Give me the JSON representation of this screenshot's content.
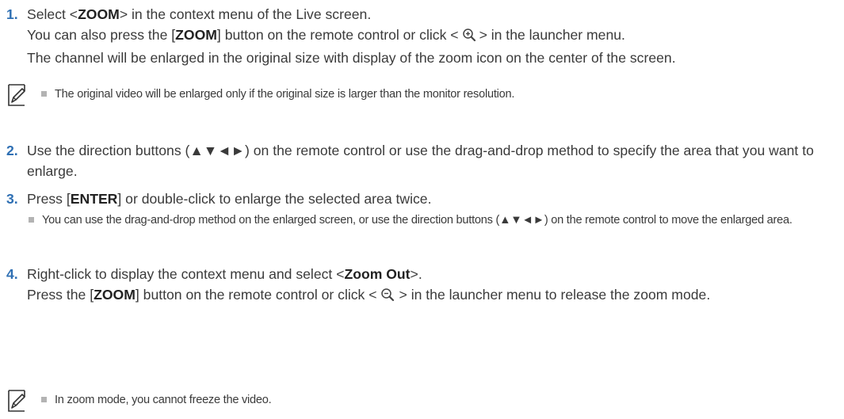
{
  "steps": [
    {
      "number": "1.",
      "l1_pre": "Select <",
      "l1_bold": "ZOOM",
      "l1_post": "> in the context menu of the Live screen.",
      "l2_pre": "You can also press the [",
      "l2_bold": "ZOOM",
      "l2_mid": "] button on the remote control or click <",
      "l2_post": "> in the launcher menu.",
      "l3": "The channel will be enlarged in the original size with display of the zoom icon on the center of the screen.",
      "icon": "zoom-in-icon"
    },
    {
      "number": "2.",
      "text": "Use the direction buttons (▲▼◄►) on the remote control or use the drag-and-drop method to specify the area that you want to enlarge."
    },
    {
      "number": "3.",
      "pre": "Press [",
      "bold": "ENTER",
      "post": "] or double-click to enlarge the selected area twice.",
      "subnote": "You can use the drag-and-drop method on the enlarged screen, or use the direction buttons (▲▼◄►) on the remote control to move the enlarged area."
    },
    {
      "number": "4.",
      "l1_pre": "Right-click to display the context menu and select <",
      "l1_bold": "Zoom Out",
      "l1_post": ">.",
      "l2_pre": "Press the [",
      "l2_bold": "ZOOM",
      "l2_mid": "] button on the remote control or click <",
      "l2_post": "> in the launcher menu to release the zoom mode.",
      "icon": "zoom-out-icon"
    }
  ],
  "notes": {
    "note1": "The original video will be enlarged only if the original size is larger than the monitor resolution.",
    "note2": "In zoom mode, you cannot freeze the video.",
    "icon": "note-pencil-icon"
  },
  "colors": {
    "step_number": "#2e6fb3",
    "text": "#3a3a3a",
    "bullet": "#b3b3b3"
  }
}
